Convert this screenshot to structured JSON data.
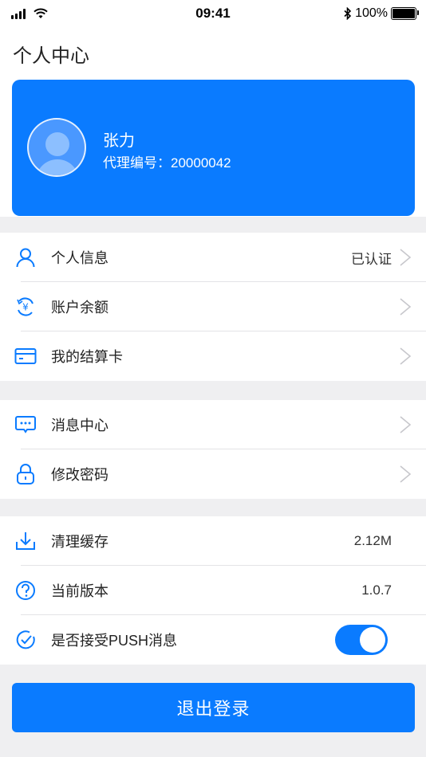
{
  "status_bar": {
    "time": "09:41",
    "battery": "100%"
  },
  "header": {
    "title": "个人中心"
  },
  "profile": {
    "name": "张力",
    "agent_label": "代理编号：",
    "agent_id": "20000042"
  },
  "group1": [
    {
      "label": "个人信息",
      "value": "已认证",
      "icon": "user-icon"
    },
    {
      "label": "账户余额",
      "value": "",
      "icon": "balance-icon"
    },
    {
      "label": "我的结算卡",
      "value": "",
      "icon": "card-icon"
    }
  ],
  "group2": [
    {
      "label": "消息中心",
      "icon": "message-icon"
    },
    {
      "label": "修改密码",
      "icon": "lock-icon"
    }
  ],
  "group3": [
    {
      "label": "清理缓存",
      "value": "2.12M",
      "icon": "download-icon"
    },
    {
      "label": "当前版本",
      "value": "1.0.7",
      "icon": "question-icon"
    },
    {
      "label": "是否接受PUSH消息",
      "toggle_on": true,
      "icon": "check-circle-icon"
    }
  ],
  "logout_label": "退出登录",
  "colors": {
    "accent": "#0a7bff",
    "background": "#efeff1"
  }
}
